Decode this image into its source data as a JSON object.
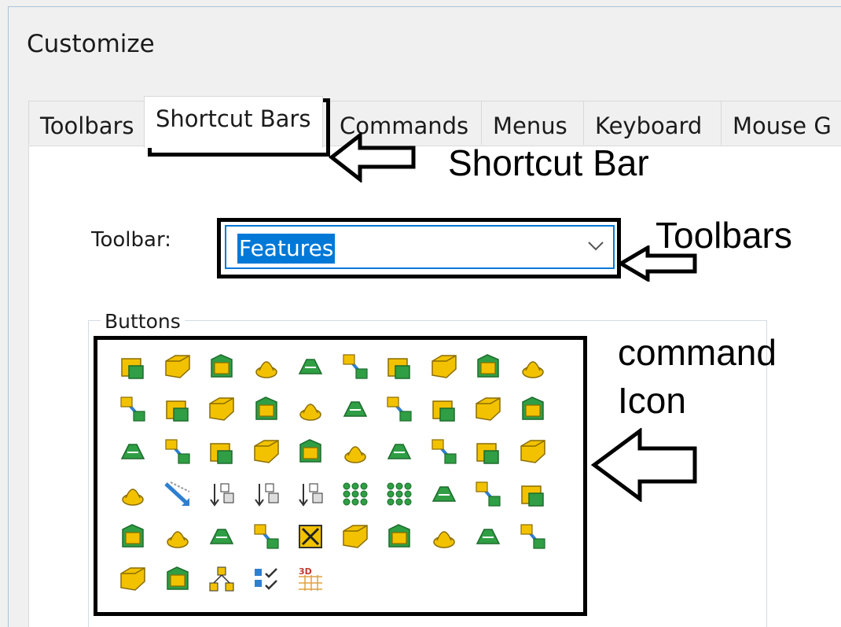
{
  "window": {
    "title": "Customize"
  },
  "tabs": [
    {
      "label": "Toolbars"
    },
    {
      "label": "Shortcut Bars",
      "active": true
    },
    {
      "label": "Commands"
    },
    {
      "label": "Menus"
    },
    {
      "label": "Keyboard"
    },
    {
      "label": "Mouse G"
    }
  ],
  "toolbar_field": {
    "label": "Toolbar:",
    "value": "Features"
  },
  "buttons_group": {
    "label": "Buttons"
  },
  "icons": [
    "extruded-boss-icon",
    "revolved-boss-icon",
    "swept-boss-icon",
    "lofted-boss-icon",
    "boundary-boss-icon",
    "extruded-cut-icon",
    "revolved-cut-icon",
    "swept-cut-icon",
    "lofted-cut-icon",
    "boundary-cut-icon",
    "fillet-icon",
    "chamfer-icon",
    "variable-fillet-icon",
    "face-fillet-icon",
    "full-round-fillet-icon",
    "linear-pattern-icon",
    "circular-pattern-icon",
    "mirror-icon",
    "rib-icon",
    "draft-icon",
    "shell-icon",
    "hole-wizard-icon",
    "advanced-hole-icon",
    "dome-icon",
    "freeform-icon",
    "deform-icon",
    "flex-icon",
    "wrap-icon",
    "intersect-icon",
    "combine-icon",
    "split-line-icon",
    "move-face-icon",
    "insert-part-icon",
    "move-copy-body-icon",
    "delete-body-icon",
    "sketch-pattern-icon",
    "curve-pattern-icon",
    "fill-pattern-icon",
    "variable-pattern-icon",
    "table-pattern-icon",
    "scale-icon",
    "indent-icon",
    "thicken-icon",
    "cavity-icon",
    "delete-face-icon",
    "replace-face-icon",
    "save-bodies-icon",
    "imported-geometry-icon",
    "curve-driven-pattern-icon",
    "sketch-driven-pattern-icon",
    "copy-feature-icon",
    "feature-works-icon",
    "instant3d-icon",
    "check-icon",
    "3d-texture-icon"
  ],
  "annotations": {
    "shortcut_bar": "Shortcut Bar",
    "toolbars": "Toolbars",
    "command_line1": "command",
    "command_line2": "Icon"
  },
  "colors": {
    "accent": "#0078d7",
    "icon_yellow": "#f2c200",
    "icon_green": "#2f9e44",
    "icon_blue": "#2f7fd0"
  }
}
